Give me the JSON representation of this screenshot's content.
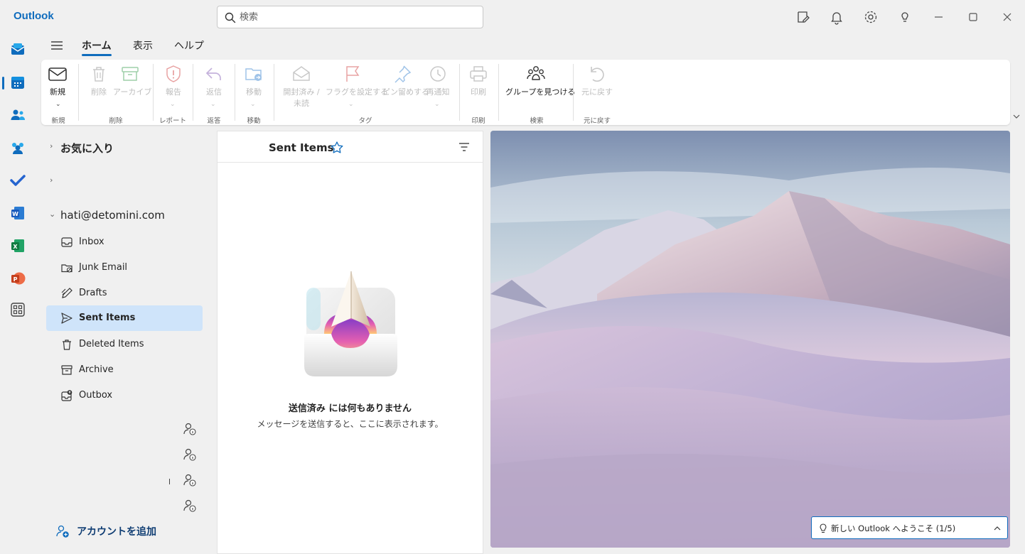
{
  "app": {
    "title": "Outlook"
  },
  "search": {
    "placeholder": "検索"
  },
  "titlebar_icons": [
    "notes-icon",
    "bell-icon",
    "settings-icon",
    "lightbulb-icon",
    "minimize-icon",
    "maximize-icon",
    "close-icon"
  ],
  "rail": [
    "mail-icon",
    "calendar-icon",
    "people-icon",
    "groups-icon",
    "todo-icon",
    "word-icon",
    "excel-icon",
    "powerpoint-icon",
    "apps-icon"
  ],
  "tabs": [
    "ホーム",
    "表示",
    "ヘルプ"
  ],
  "ribbon": {
    "new": "新規",
    "delete": "削除",
    "archive": "アーカイブ",
    "report": "報告",
    "reply": "返信",
    "move": "移動",
    "read_unread_1": "開封済み /",
    "read_unread_2": "未読",
    "flag": "フラグを設定する",
    "pin": "ピン留めする",
    "snooze": "再通知",
    "print": "印刷",
    "find_groups": "グループを見つける",
    "undo": "元に戻す",
    "groups": {
      "new": "新規",
      "delete": "削除",
      "report": "レポート",
      "respond": "返答",
      "move": "移動",
      "tags": "タグ",
      "print": "印刷",
      "find": "検索",
      "undo": "元に戻す"
    }
  },
  "folders": {
    "favorites": "お気に入り",
    "account": "hati@detomini.com",
    "items": [
      {
        "name": "Inbox",
        "icon": "inbox-icon"
      },
      {
        "name": "Junk Email",
        "icon": "junk-icon"
      },
      {
        "name": "Drafts",
        "icon": "drafts-icon"
      },
      {
        "name": "Sent Items",
        "icon": "send-icon",
        "selected": true
      },
      {
        "name": "Deleted Items",
        "icon": "trash-icon"
      },
      {
        "name": "Archive",
        "icon": "archive-icon"
      },
      {
        "name": "Outbox",
        "icon": "outbox-icon"
      }
    ],
    "add_account": "アカウントを追加"
  },
  "message_list": {
    "title": "Sent Items",
    "empty_title": "送信済み には何もありません",
    "empty_sub": "メッセージを送信すると、ここに表示されます。"
  },
  "welcome": {
    "text": "新しい Outlook へようこそ (1/5)"
  },
  "colors": {
    "accent": "#0f6cbd",
    "selected": "#cfe4fa"
  }
}
